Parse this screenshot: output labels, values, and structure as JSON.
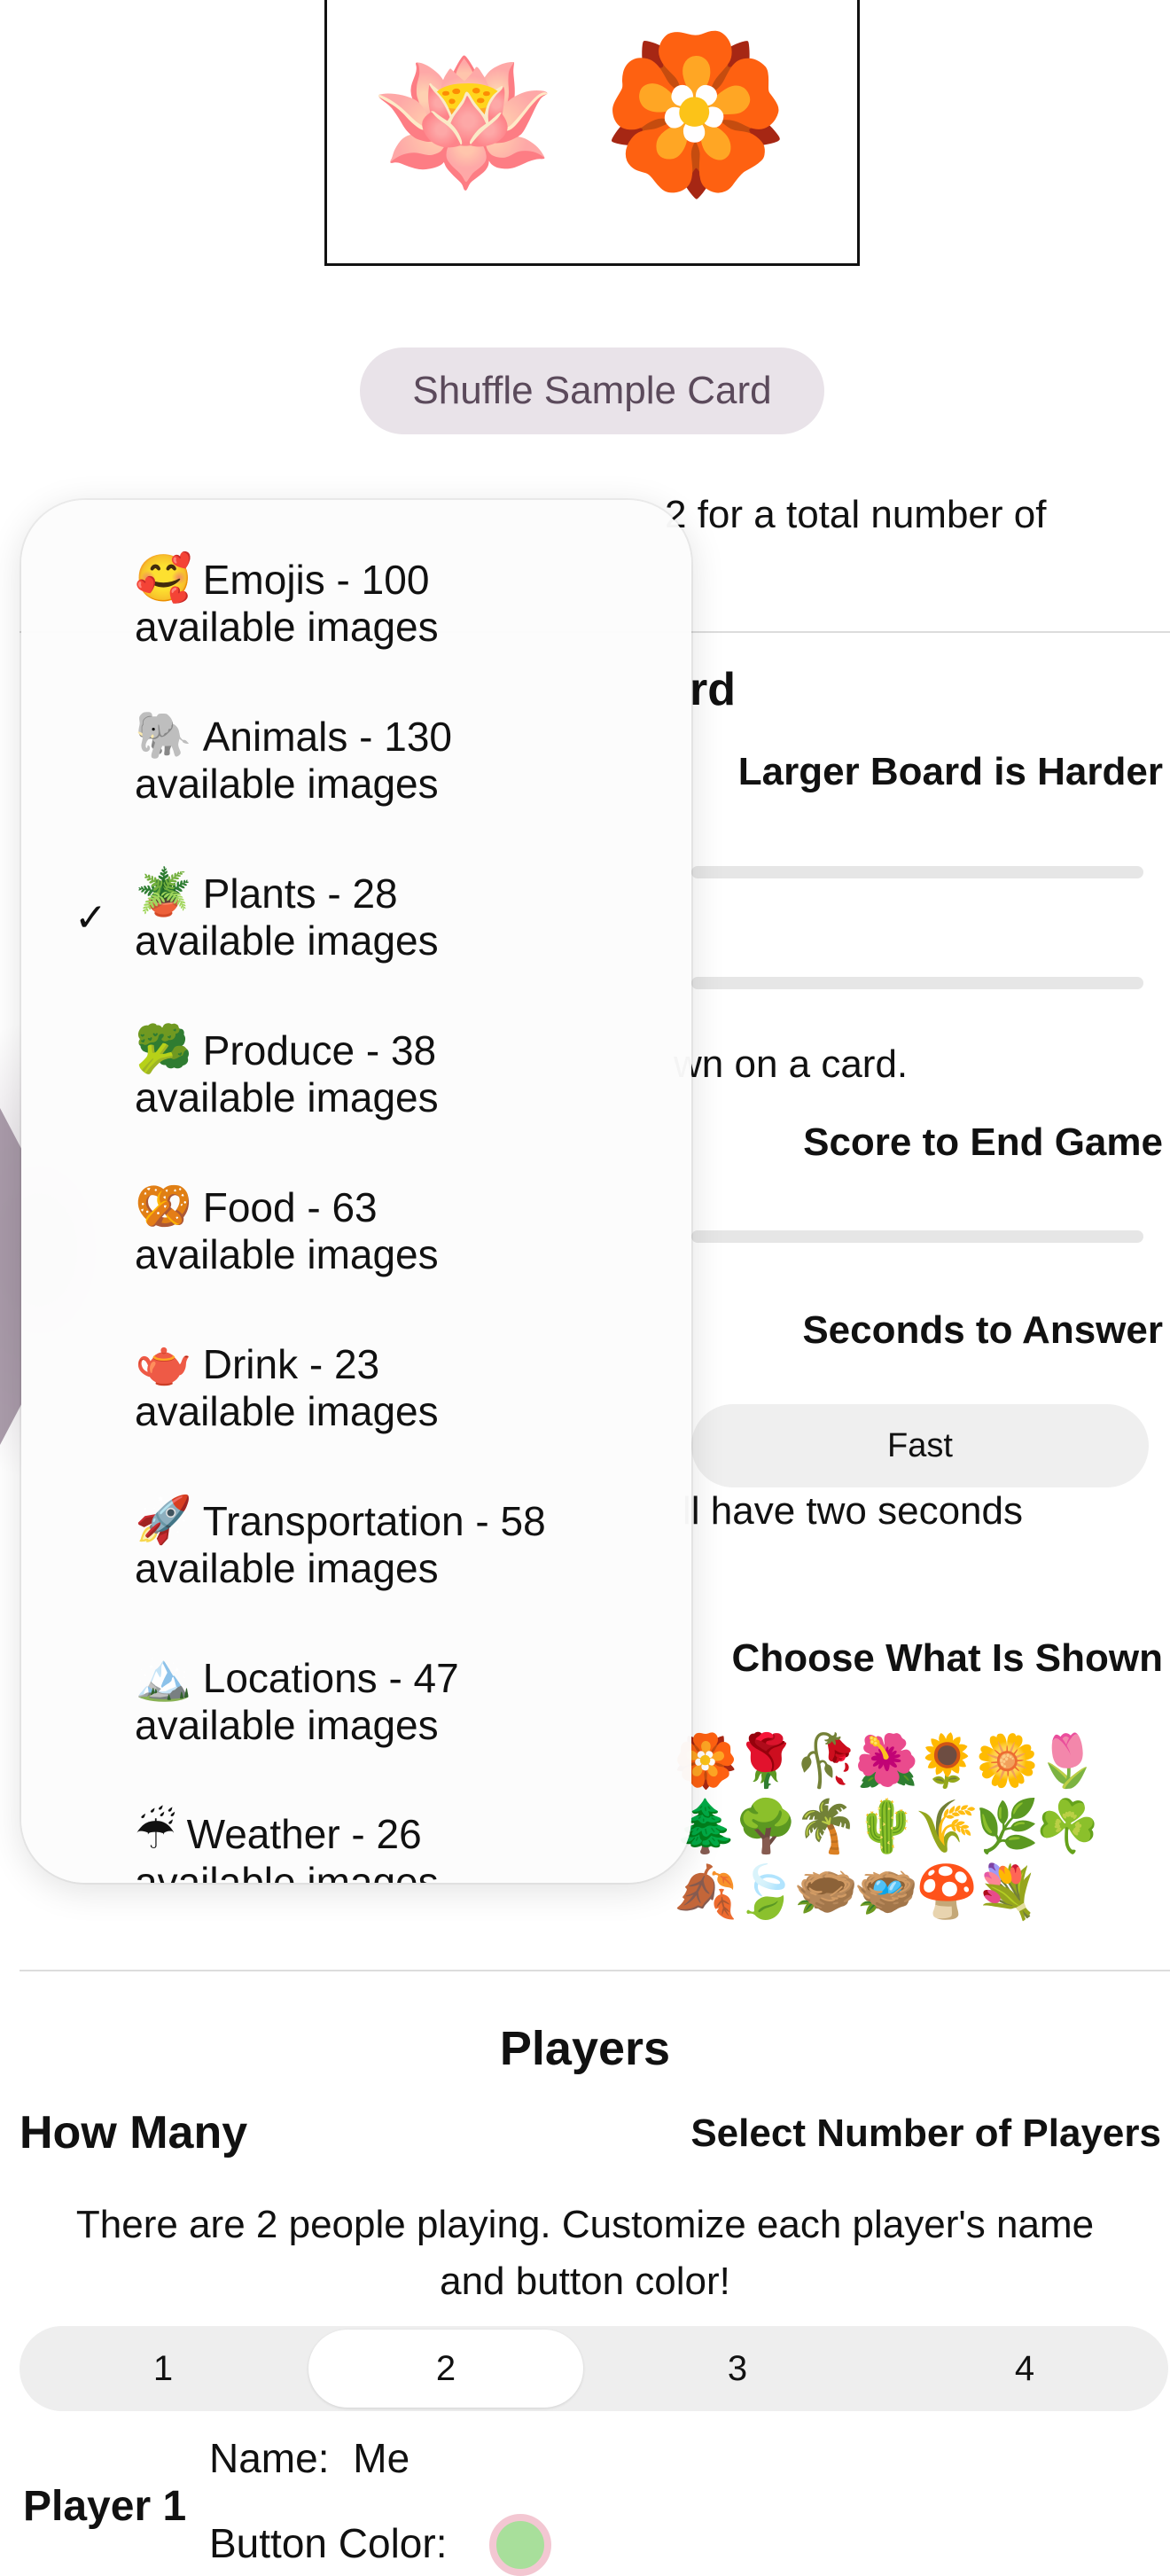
{
  "sample_card": {
    "emojis": [
      "🪷",
      "🏵️"
    ]
  },
  "shuffle_label": "Shuffle Sample Card",
  "hint_fragment": "2 for a total number of",
  "board": {
    "title_fragment": "rd",
    "size_label": "Larger Board is Harder",
    "shown_fragment": "wn on a card.",
    "score_label": "Score to End Game",
    "seconds_label": "Seconds to Answer",
    "speed_option": "Fast",
    "seconds_fragment": "ll have two seconds",
    "choose_label": "Choose What Is Shown"
  },
  "emoji_preview": [
    [
      "🏵️",
      "🌹",
      "🥀",
      "🌺",
      "🌻",
      "🌼",
      "🌷"
    ],
    [
      "🌲",
      "🌳",
      "🌴",
      "🌵",
      "🌾",
      "🌿",
      "☘️"
    ],
    [
      "🍂",
      "🍃",
      "🪹",
      "🪺",
      "🍄",
      "💐"
    ]
  ],
  "menu": {
    "items": [
      {
        "icon": "🥰",
        "line1": "Emojis - 100",
        "line2": "available images",
        "checked": false
      },
      {
        "icon": "🐘",
        "line1": "Animals - 130",
        "line2": "available images",
        "checked": false
      },
      {
        "icon": "🪴",
        "line1": "Plants - 28",
        "line2": "available images",
        "checked": true
      },
      {
        "icon": "🥦",
        "line1": "Produce - 38",
        "line2": "available images",
        "checked": false
      },
      {
        "icon": "🥨",
        "line1": "Food - 63",
        "line2": "available images",
        "checked": false
      },
      {
        "icon": "🫖",
        "line1": "Drink - 23",
        "line2": "available images",
        "checked": false
      },
      {
        "icon": "🚀",
        "line1": "Transportation - 58",
        "line2": "available images",
        "checked": false
      },
      {
        "icon": "🏔️",
        "line1": "Locations - 47",
        "line2": "available images",
        "checked": false
      },
      {
        "icon": "☔",
        "line1": "Weather - 26",
        "line2": "available images",
        "checked": false
      }
    ],
    "check_mark": "✓"
  },
  "players": {
    "title": "Players",
    "how_many": "How Many",
    "select_label": "Select Number of Players",
    "description": "There are 2 people playing. Customize each player's name and button color!",
    "options": [
      "1",
      "2",
      "3",
      "4"
    ],
    "selected": "2",
    "player1": {
      "label": "Player 1",
      "name_label": "Name:",
      "name_value": "Me",
      "color_label": "Button Color:",
      "color": "#a8df9b"
    }
  }
}
